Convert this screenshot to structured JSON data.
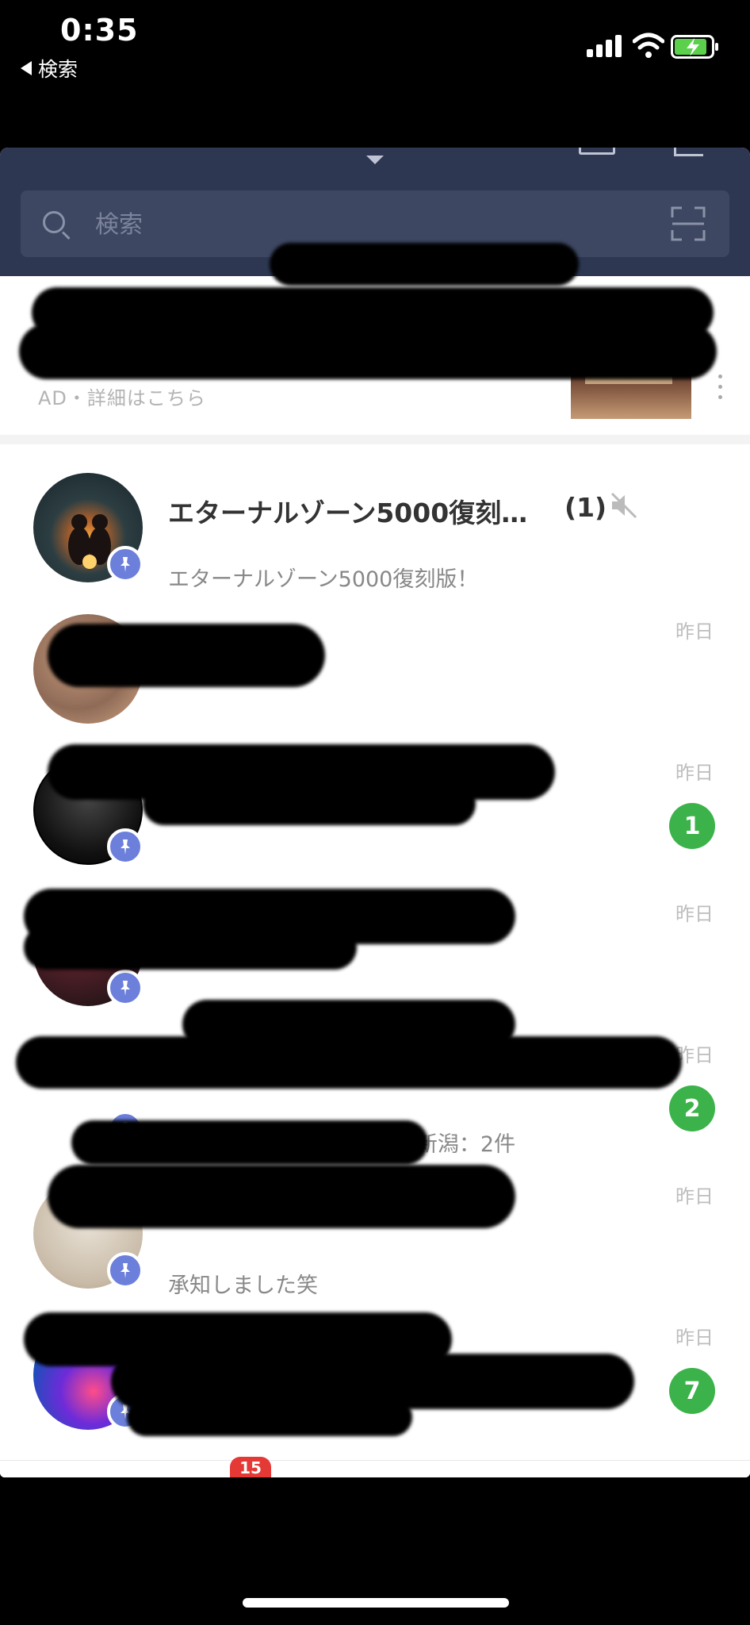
{
  "status_bar": {
    "time": "0:35",
    "back_label": "検索"
  },
  "header": {
    "search": {
      "placeholder": "検索"
    }
  },
  "ad": {
    "label": "AD・詳細はこちら"
  },
  "chats": [
    {
      "name": "エターナルゾーン5000復刻…",
      "count": "(1)",
      "muted": true,
      "preview": "エターナルゾーン5000復刻版！",
      "time": "",
      "badge": ""
    },
    {
      "name": "",
      "count": "",
      "muted": false,
      "preview": "",
      "time": "昨日",
      "badge": ""
    },
    {
      "name": "",
      "count": "",
      "muted": false,
      "preview": "",
      "time": "昨日",
      "badge": "1"
    },
    {
      "name": "",
      "count": "",
      "muted": false,
      "preview": "",
      "time": "昨日",
      "badge": ""
    },
    {
      "name": "",
      "count": "",
      "muted": false,
      "preview": "件 新潟：1件 ・調理補助 新潟：2件",
      "time": "昨日",
      "badge": "2"
    },
    {
      "name": "",
      "count": "",
      "muted": false,
      "preview": "承知しました笑",
      "time": "昨日",
      "badge": ""
    },
    {
      "name": "",
      "count": "",
      "muted": false,
      "preview": "",
      "time": "昨日",
      "badge": "7"
    }
  ],
  "tab_bar": {
    "badge": "15"
  },
  "colors": {
    "header_bg": "#2d3752",
    "badge_green": "#3cb34a",
    "pin_blue": "#6b7fdb",
    "tab_badge_red": "#e53935"
  }
}
